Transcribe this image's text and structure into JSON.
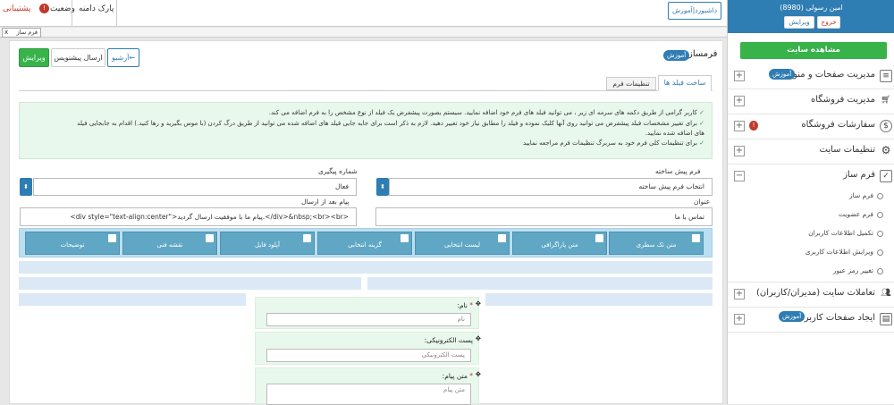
{
  "topbar": {
    "dashboard_btn": "داشبورد|آموزش",
    "support": "پشتیبانی",
    "status": "وضعیت",
    "domain_park": "پارک دامنه"
  },
  "tabstrip": {
    "open_tab": "فرم ساز"
  },
  "user": {
    "name": "امین رسولی (8980)",
    "edit": "ویرایش",
    "logout": "خروج"
  },
  "sidebar": {
    "view_site": "مشاهده سایت",
    "items": [
      {
        "label": "مدیریت صفحات و منوها",
        "badge": "آموزش",
        "icon": "page-icon"
      },
      {
        "label": "مدیریت فروشگاه",
        "badge": "",
        "icon": "cart-icon"
      },
      {
        "label": "سفارشات فروشگاه",
        "badge": "",
        "icon": "dollar-icon"
      },
      {
        "label": "تنظیمات سایت",
        "badge": "",
        "icon": "gear-icon"
      },
      {
        "label": "فرم ساز",
        "badge": "",
        "icon": "checkbox-icon"
      },
      {
        "label": "تعاملات سایت (مدیران/کاربران)",
        "badge": "",
        "icon": "users-icon"
      },
      {
        "label": "ایجاد صفحات کاربران",
        "badge": "آموزش",
        "icon": "layout-icon"
      }
    ],
    "subitems": [
      "فرم ساز",
      "فرم عضویت",
      "تکمیل اطلاعات کاربران",
      "ویرایش اطلاعات کاربری",
      "تغییر رمز عبور"
    ]
  },
  "page": {
    "title": "فرمساز",
    "title_badge": "آموزش",
    "btn_edit": "ویرایش",
    "btn_suggest": "ارسال پیشنویس",
    "btn_archive": "آرشیو",
    "tab_build": "ساخت فیلد ها",
    "tab_settings": "تنظیمات فرم"
  },
  "info": {
    "line1": "کاربر گرامی از طریق دکمه های سرمه ای زیر ، می توانید فیلد های فرم خود اضافه نمایید. سیستم بصورت پیشفرض یک فیلد از نوع مشخص را به فرم اضافه می کند.",
    "line2": "برای تغییر مشخصات فیلد پیشفرض می توانید روی آنها کلیک نموده و فیلد را مطابق نیاز خود تغییر دهید. لازم به ذکر است برای جابه جایی فیلد های اضافه شده می توانید از طریق درگ کردن (با موس بگیرید و رها کنید.) اقدام به جابجایی فیلد",
    "line2b": "های اضافه شده نمایید.",
    "line3": "برای تنظیمات کلی فرم خود به سربرگ تنظیمات فرم مراجعه نمایید"
  },
  "form": {
    "prebuilt_label": "فرم پیش ساخته",
    "prebuilt_value": "انتخاب فرم پیش ساخته",
    "tracking_label": "شماره پیگیری",
    "tracking_value": "فعال",
    "title_label": "عنوان",
    "title_value": "تماس با ما",
    "after_send_label": "پیام بعد از ارسال",
    "after_send_value": "<div style=\"text-align:center\">پیام ما با موفقیت ارسال گردید.</div>&nbsp;<br><br>"
  },
  "palette": [
    "متن تک سطری",
    "متن پاراگرافی",
    "لیست انتخابی",
    "گزینه انتخابی",
    "آپلود فایل",
    "نقشه فنی",
    "توضیحات"
  ],
  "fields": [
    {
      "label": "نام:",
      "required": "*",
      "placeholder": "نام"
    },
    {
      "label": "پست الکترونیکی:",
      "required": "",
      "placeholder": "پست الکترونیکی"
    },
    {
      "label": "متن پیام:",
      "required": "*",
      "placeholder": "متن پیام"
    }
  ]
}
